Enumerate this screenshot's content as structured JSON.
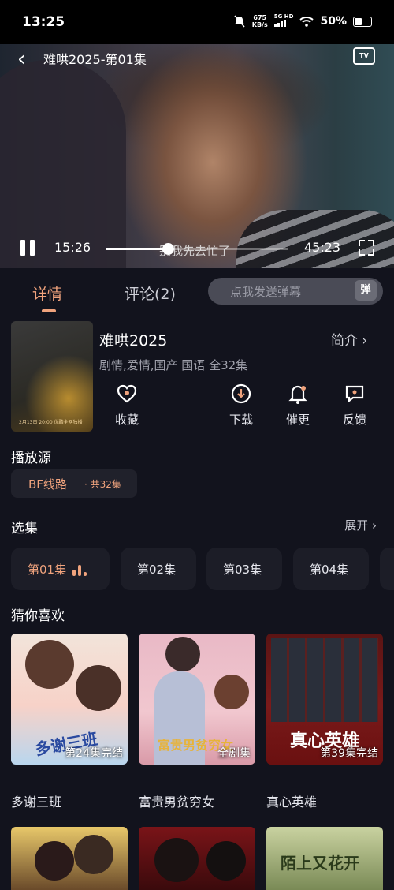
{
  "status": {
    "time": "13:25",
    "speed": "675",
    "speed_unit": "KB/s",
    "network": "5G HD",
    "battery": "50%"
  },
  "video": {
    "title": "难哄2025-第01集",
    "tv_label": "TV",
    "current_time": "15:26",
    "total_time": "45:23",
    "progress": 0.34,
    "subtitle": "别我先去忙了"
  },
  "tabs": [
    {
      "label": "详情"
    },
    {
      "label": "评论(2)"
    }
  ],
  "danmaku": {
    "placeholder": "点我发送弹幕",
    "button": "弹"
  },
  "show": {
    "title": "难哄2025",
    "meta": "剧情,爱情,国产 国语 全32集",
    "intro": "简介",
    "poster_text": "2月13日 20:00 优酷全网独播"
  },
  "actions": [
    {
      "label": "收藏"
    },
    {
      "label": "下载"
    },
    {
      "label": "催更"
    },
    {
      "label": "反馈"
    }
  ],
  "source": {
    "heading": "播放源",
    "name": "BF线路",
    "count": "· 共32集"
  },
  "episodes": {
    "heading": "选集",
    "expand": "展开",
    "items": [
      "第01集",
      "第02集",
      "第03集",
      "第04集"
    ]
  },
  "recommend": {
    "heading": "猜你喜欢",
    "items": [
      {
        "title": "多谢三班",
        "badge": "第24集完结",
        "art": "多谢三班"
      },
      {
        "title": "富贵男贫穷女",
        "badge": "全剧集",
        "art": "富贵男贫穷女"
      },
      {
        "title": "真心英雄",
        "badge": "第39集完结",
        "art": "真心英雄"
      }
    ],
    "partial_art": "陌上又花开"
  },
  "colors": {
    "accent": "#f0a37d",
    "background": "#12131d",
    "card": "#1c1d27"
  }
}
